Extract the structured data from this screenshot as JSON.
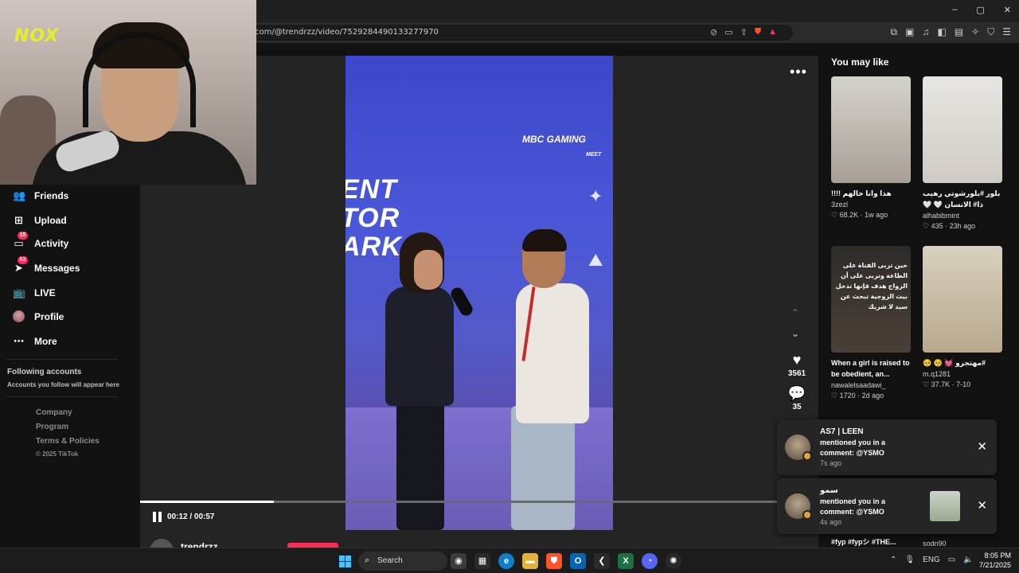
{
  "browser": {
    "url": "com/@trendrzz/video/7529284490133277970",
    "window_controls": [
      "–",
      "▢",
      "✕"
    ]
  },
  "webcam": {
    "logo": "NOX"
  },
  "sidebar": {
    "items": [
      {
        "label": "Friends",
        "icon": "friends-icon"
      },
      {
        "label": "Upload",
        "icon": "upload-icon"
      },
      {
        "label": "Activity",
        "icon": "activity-icon",
        "badge": "15"
      },
      {
        "label": "Messages",
        "icon": "messages-icon",
        "badge": "63"
      },
      {
        "label": "LIVE",
        "icon": "live-icon"
      },
      {
        "label": "Profile",
        "icon": "profile-avatar"
      },
      {
        "label": "More",
        "icon": "more-icon"
      }
    ],
    "following_title": "Following accounts",
    "following_note": "Accounts you follow will appear here",
    "footer_links": [
      "Company",
      "Program",
      "Terms & Policies"
    ],
    "copyright": "© 2025 TikTok"
  },
  "player": {
    "banner_text": "ENT\nTOR\nARK",
    "sponsor_logo": "MBC GAMING",
    "sponsor_sub": "MEET",
    "likes": "3561",
    "comments": "35",
    "current_time": "00:12",
    "duration": "00:57",
    "time_display": "00:12 / 00:57",
    "progress_fraction": 0.2105,
    "author": "trendrzz"
  },
  "you_may_like": {
    "title": "You may like",
    "items": [
      {
        "caption": "هذا وانا خالهم !!!!",
        "author": "3zezl",
        "likes": "68.2K",
        "age": "1w ago"
      },
      {
        "caption": "بلور #بلورشوتي رهيب ذا# الانسان 🤍 🤍",
        "author": "alhabibmint",
        "likes": "435",
        "age": "23h ago"
      },
      {
        "caption": "When a girl is raised to be obedient, an...",
        "author": "nawalelsaadawi_",
        "likes": "1720",
        "age": "2d ago",
        "overlay": "حين تربى الفتاة على الطاعة وتربى على أن الزواج هدف فإنها تدخل بيت الزوجية تبحث عن سيد لا شريك"
      },
      {
        "caption": "#مهتجرو 💓 🥺 🥺",
        "author": "m.q1281",
        "likes": "37.7K",
        "age": "7-10"
      }
    ],
    "partial_captions": [
      "#fyp #fypシ #THE...",
      "sodn90"
    ]
  },
  "notifications": [
    {
      "title": "AS7 | LEEN",
      "body": "mentioned you in a comment: @YSMO",
      "time": "7s ago"
    },
    {
      "title": "ﺳﻤﻮ",
      "body": "mentioned you in a comment: @YSMO",
      "time": "4s ago"
    }
  ],
  "taskbar": {
    "search_placeholder": "Search",
    "language": "ENG",
    "time": "8:05 PM",
    "date": "7/21/2025"
  },
  "colors": {
    "accent": "#fe2c55",
    "background": "#121212",
    "player_bg": "#242424"
  }
}
